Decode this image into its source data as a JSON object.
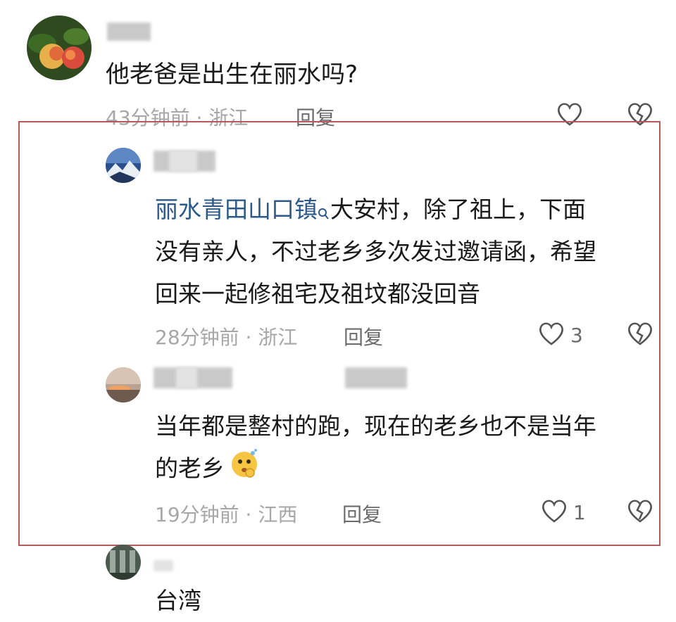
{
  "comments": [
    {
      "text": "他老爸是出生在丽水吗?",
      "time": "43分钟前",
      "location": "浙江",
      "reply_label": "回复",
      "likes": ""
    },
    {
      "link_text": "丽水青田山口镇",
      "text_line1": "大安村，除了祖上，下面",
      "text_line2": "没有亲人，不过老乡多次发过邀请函，希望",
      "text_line3": "回来一起修祖宅及祖坟都没回音",
      "time": "28分钟前",
      "location": "浙江",
      "reply_label": "回复",
      "likes": "3"
    },
    {
      "text_line1": "当年都是整村的跑，现在的老乡也不是当年",
      "text_line2": "的老乡",
      "time": "19分钟前",
      "location": "江西",
      "reply_label": "回复",
      "likes": "1"
    },
    {
      "text": "台湾"
    }
  ],
  "separator": "·",
  "colors": {
    "highlight_border": "#b45a5a",
    "link": "#2b5a8a",
    "meta": "#a7a7a7"
  }
}
